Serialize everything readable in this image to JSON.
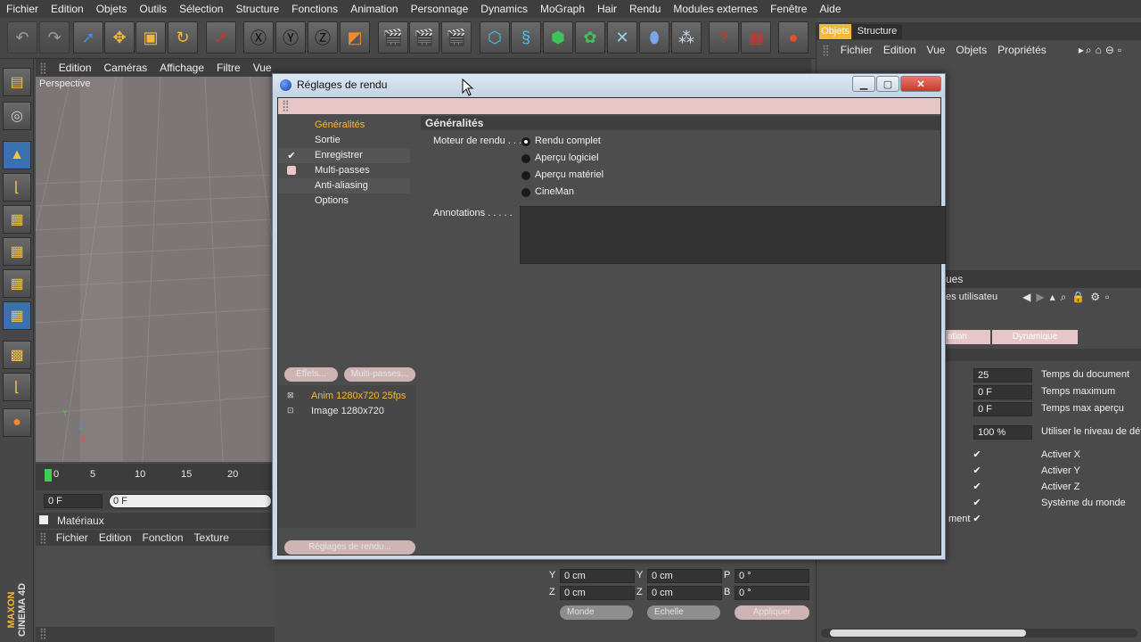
{
  "menubar": {
    "items": [
      "Fichier",
      "Edition",
      "Objets",
      "Outils",
      "Sélection",
      "Structure",
      "Fonctions",
      "Animation",
      "Personnage",
      "Dynamics",
      "MoGraph",
      "Hair",
      "Rendu",
      "Modules externes",
      "Fenêtre",
      "Aide"
    ]
  },
  "viewport": {
    "menu": [
      "Edition",
      "Caméras",
      "Affichage",
      "Filtre",
      "Vue"
    ],
    "label": "Perspective"
  },
  "timeline": {
    "ticks": [
      "0",
      "5",
      "10",
      "15",
      "20"
    ],
    "frame_value": "0 F",
    "frame_value2": "0 F"
  },
  "materials": {
    "title": "Matériaux",
    "menu": [
      "Fichier",
      "Edition",
      "Fonction",
      "Texture"
    ]
  },
  "objects_panel": {
    "tabs": [
      "Objets",
      "Structure"
    ],
    "menu": [
      "Fichier",
      "Edition",
      "Vue",
      "Objets",
      "Propriétés"
    ]
  },
  "attributes_panel": {
    "tab_partial": "ues",
    "mode_partial": "es utilisateu",
    "button1": "ation",
    "button2": "Dynamique",
    "rows": [
      {
        "value": "25",
        "label": "Temps du document"
      },
      {
        "value": "0 F",
        "label": "Temps maximum"
      },
      {
        "value": "0 F",
        "label": "Temps max aperçu"
      },
      {
        "value": "100 %",
        "label": "Utiliser le niveau de déta"
      }
    ],
    "checks": [
      "Activer X",
      "Activer Y",
      "Activer Z",
      "Système du monde"
    ],
    "last_partial": "ment"
  },
  "coords": {
    "y_label": "Y",
    "y_value": "0 cm",
    "y2_label": "Y",
    "y2_value": "0 cm",
    "p_label": "P",
    "p_value": "0 °",
    "z_label": "Z",
    "z_value": "0 cm",
    "z2_label": "Z",
    "z2_value": "0 cm",
    "b_label": "B",
    "b_value": "0 °",
    "dropdown1": "Monde",
    "dropdown2": "Echelle",
    "apply": "Appliquer"
  },
  "dialog": {
    "title": "Réglages de rendu",
    "nav": [
      "Généralités",
      "Sortie",
      "Enregistrer",
      "Multi-passes",
      "Anti-aliasing",
      "Options"
    ],
    "section_title": "Généralités",
    "engine_label": "Moteur de rendu . . .",
    "engines": [
      "Rendu complet",
      "Aperçu logiciel",
      "Aperçu matériel",
      "CineMan"
    ],
    "annotations_label": "Annotations . . . . .",
    "btn_effets": "Effets...",
    "btn_multipasses": "Multi-passes...",
    "presets": [
      "Anim 1280x720 25fps",
      "Image 1280x720"
    ],
    "btn_render_settings": "Réglages de rendu..."
  },
  "branding": {
    "maxon": "MAXON",
    "cinema": "CINEMA 4D"
  },
  "colors": {
    "accent": "#f5b73a",
    "dialog_frame": "#c9d7e6",
    "close_red": "#c9382d",
    "panel": "#4d4d4d"
  }
}
